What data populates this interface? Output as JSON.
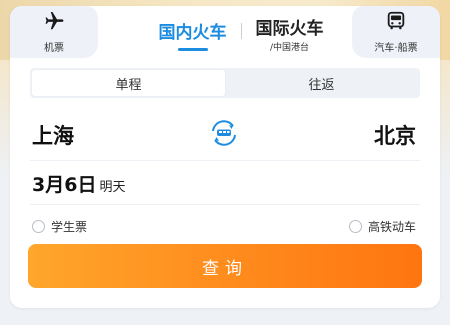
{
  "tabs": {
    "flight": {
      "label": "机票",
      "icon": "airplane-icon"
    },
    "domestic_train": {
      "label": "国内火车"
    },
    "intl_train": {
      "label": "国际火车",
      "sublabel": "/中国港台"
    },
    "bus_ship": {
      "label": "汽车·船票",
      "icon": "bus-icon"
    }
  },
  "trip_type": {
    "one_way": "单程",
    "round_trip": "往返",
    "selected": "one_way"
  },
  "route": {
    "from": "上海",
    "to": "北京",
    "swap_icon": "swap-train-icon"
  },
  "date": {
    "value": "3月6日",
    "weekday": "明天"
  },
  "options": {
    "student": "学生票",
    "high_speed": "高铁动车"
  },
  "search": {
    "label": "查询"
  },
  "colors": {
    "accent_blue": "#1c8ce0",
    "button_orange_start": "#ffa62b",
    "button_orange_end": "#ff7510"
  }
}
